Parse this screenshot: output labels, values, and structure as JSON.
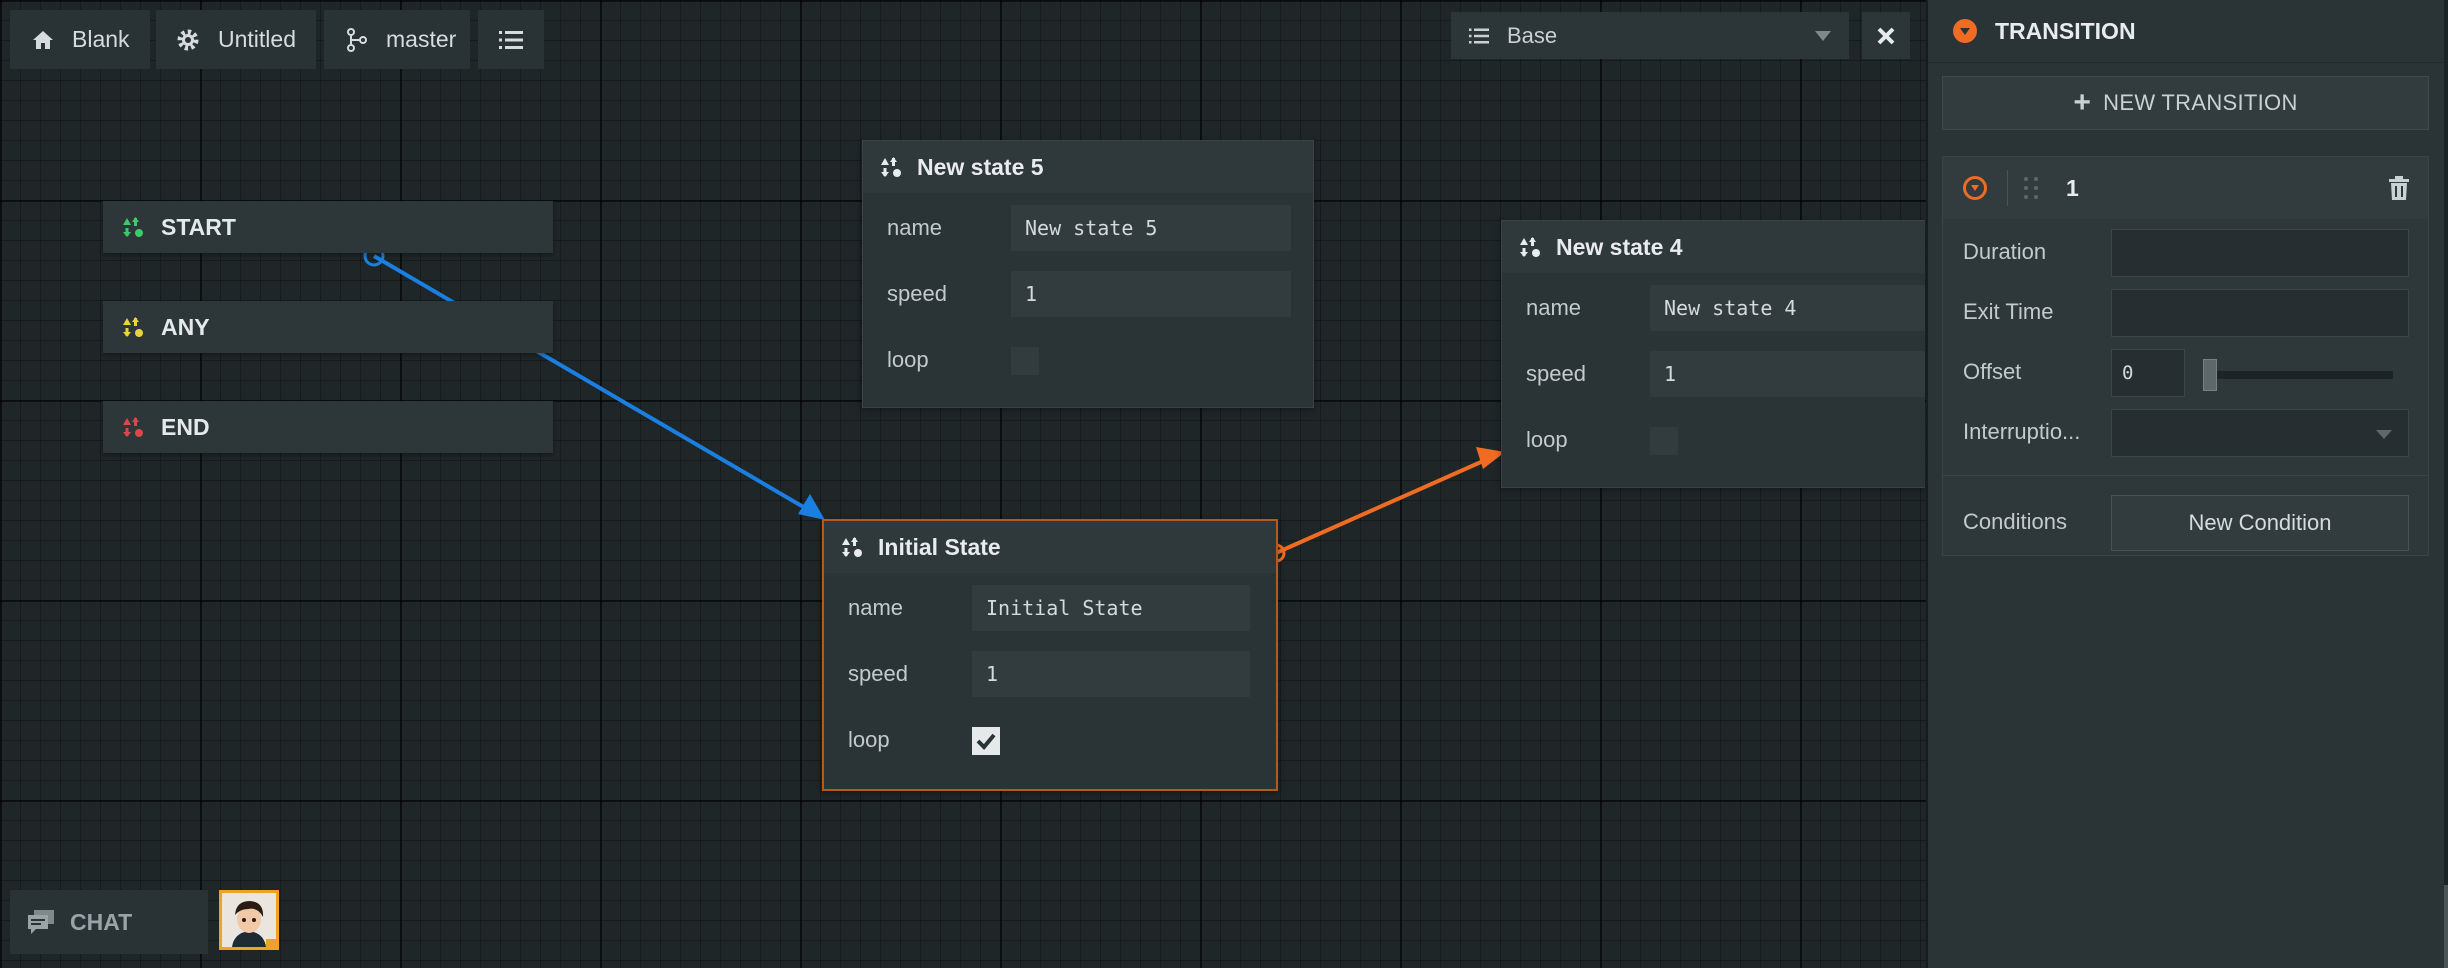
{
  "toolbar": {
    "home_label": "Blank",
    "project_label": "Untitled",
    "branch_label": "master",
    "layer_select": "Base"
  },
  "entry_nodes": {
    "start": "START",
    "any": "ANY",
    "end": "END"
  },
  "states": {
    "new_state_5": {
      "title": "New state 5",
      "name_label": "name",
      "name_value": "New state 5",
      "speed_label": "speed",
      "speed_value": "1",
      "loop_label": "loop",
      "loop_checked": false
    },
    "new_state_4": {
      "title": "New state 4",
      "name_label": "name",
      "name_value": "New state 4",
      "speed_label": "speed",
      "speed_value": "1",
      "loop_label": "loop",
      "loop_checked": false
    },
    "initial_state": {
      "title": "Initial State",
      "name_label": "name",
      "name_value": "Initial State",
      "speed_label": "speed",
      "speed_value": "1",
      "loop_label": "loop",
      "loop_checked": true
    }
  },
  "chat": {
    "label": "CHAT"
  },
  "panel": {
    "title": "TRANSITION",
    "new_transition_label": "NEW TRANSITION",
    "transition": {
      "index": "1",
      "duration_label": "Duration",
      "duration_value": "",
      "exit_time_label": "Exit Time",
      "exit_time_value": "",
      "offset_label": "Offset",
      "offset_value": "0",
      "interruption_label": "Interruptio...",
      "interruption_value": "",
      "conditions_label": "Conditions",
      "new_condition_label": "New Condition"
    }
  },
  "colors": {
    "start_green": "#3ec96a",
    "any_yellow": "#e8d33a",
    "end_red": "#d94848",
    "accent_orange": "#ef6c22",
    "edge_blue": "#1a7fe0"
  }
}
